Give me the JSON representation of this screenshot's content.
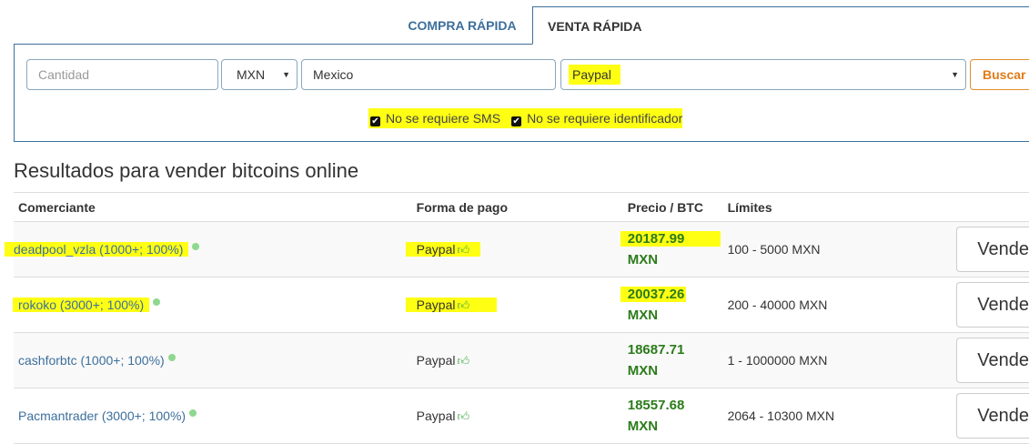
{
  "tabs": {
    "compra": "COMPRA RÁPIDA",
    "venta": "VENTA RÁPIDA"
  },
  "search": {
    "cantidad_placeholder": "Cantidad",
    "cantidad_value": "",
    "moneda": "MXN",
    "pais": "Mexico",
    "forma_pago": "Paypal",
    "buscar_label": "Buscar",
    "check_sms": "No se requiere SMS",
    "check_id": "No se requiere identificador"
  },
  "results": {
    "title": "Resultados para vender bitcoins online",
    "headers": {
      "trader": "Comerciante",
      "pago": "Forma de pago",
      "precio": "Precio / BTC",
      "limites": "Límites"
    },
    "rows": [
      {
        "trader": "deadpool_vzla (1000+; 100%)",
        "pago": "Paypal",
        "precio": "20187.99",
        "moneda": "MXN",
        "limites": "100 - 5000 MXN",
        "accion": "Vende",
        "highlight": true
      },
      {
        "trader": "rokoko (3000+; 100%)",
        "pago": "Paypal",
        "precio": "20037.26",
        "moneda": "MXN",
        "limites": "200 - 40000 MXN",
        "accion": "Vende",
        "highlight": true
      },
      {
        "trader": "cashforbtc (1000+; 100%)",
        "pago": "Paypal",
        "precio": "18687.71",
        "moneda": "MXN",
        "limites": "1 - 1000000 MXN",
        "accion": "Vende",
        "highlight": false
      },
      {
        "trader": "Pacmantrader (3000+; 100%)",
        "pago": "Paypal",
        "precio": "18557.68",
        "moneda": "MXN",
        "limites": "2064 - 10300 MXN",
        "accion": "Vende",
        "highlight": false
      }
    ]
  },
  "colors": {
    "accent": "#3c6f9c",
    "highlight": "#ffff14",
    "price": "#2c7b1b",
    "buscar": "#e07b17",
    "online_dot": "#8fd88f"
  },
  "icons": {
    "thumb": "thumbs-up-icon",
    "online": "online-dot-icon",
    "caret": "caret-down-icon",
    "checkbox": "checkbox-checked-icon"
  }
}
